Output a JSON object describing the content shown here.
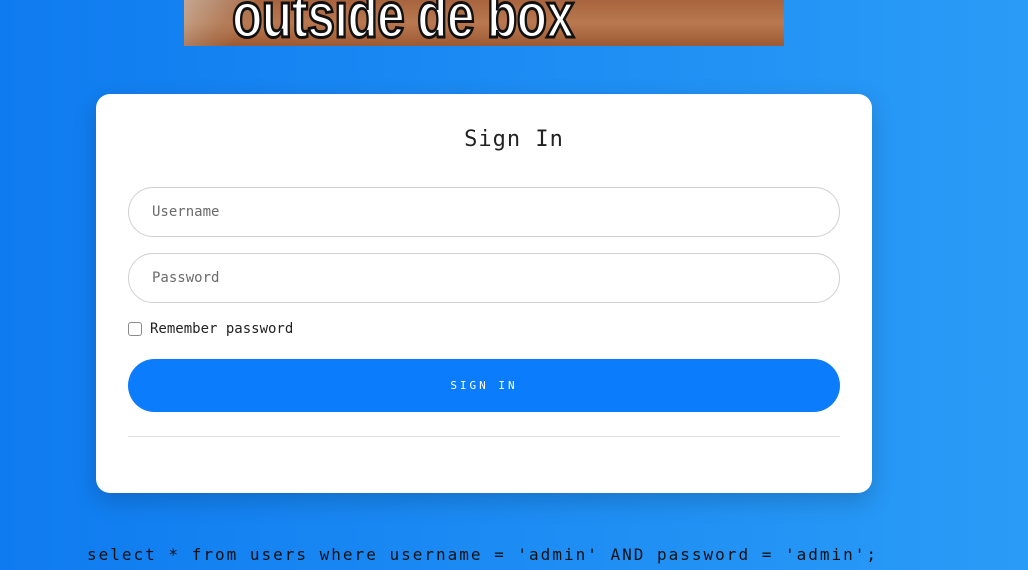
{
  "banner": {
    "text": "outside de box"
  },
  "form": {
    "title": "Sign In",
    "username_placeholder": "Username",
    "password_placeholder": "Password",
    "remember_label": "Remember password",
    "submit_label": "SIGN IN"
  },
  "footer": {
    "query": "select * from users where username = 'admin' AND password = 'admin';"
  },
  "colors": {
    "accent": "#0a7cfc",
    "background_start": "#0f7bf0",
    "background_end": "#2a9cf7"
  }
}
